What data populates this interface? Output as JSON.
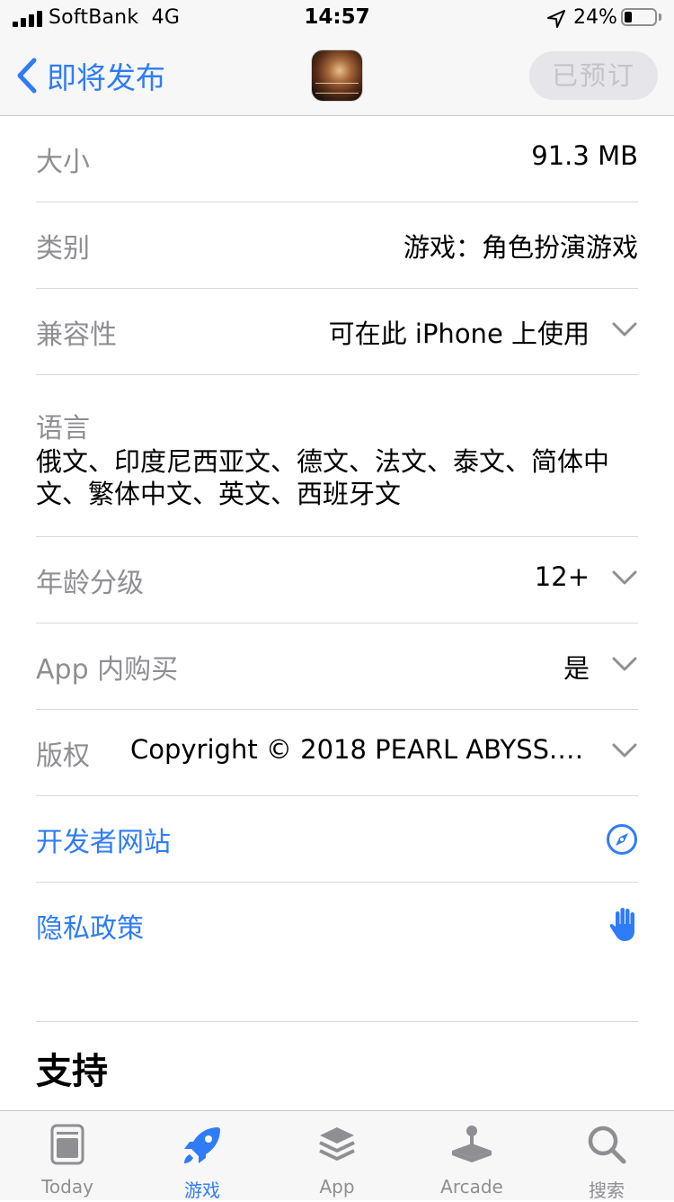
{
  "status_bar": {
    "carrier": "SoftBank",
    "network": "4G",
    "time": "14:57",
    "battery_percent": "24%",
    "battery_level": 0.24
  },
  "nav": {
    "back_label": "即将发布",
    "preorder_label": "已预订"
  },
  "info": {
    "size": {
      "label": "大小",
      "value": "91.3 MB"
    },
    "category": {
      "label": "类别",
      "value": "游戏：角色扮演游戏"
    },
    "compatibility": {
      "label": "兼容性",
      "value": "可在此 iPhone 上使用"
    },
    "languages": {
      "label": "语言",
      "value": "俄文、印度尼西亚文、德文、法文、泰文、简体中文、繁体中文、英文、西班牙文"
    },
    "age_rating": {
      "label": "年龄分级",
      "value": "12+"
    },
    "in_app_purchase": {
      "label": "App 内购买",
      "value": "是"
    },
    "copyright": {
      "label": "版权",
      "value": "Copyright © 2018 PEARL ABYSS. Al..."
    },
    "developer_site": {
      "label": "开发者网站"
    },
    "privacy_policy": {
      "label": "隐私政策"
    }
  },
  "section": {
    "support_title": "支持"
  },
  "tabs": [
    {
      "label": "Today",
      "icon": "today-icon",
      "active": false
    },
    {
      "label": "游戏",
      "icon": "rocket-icon",
      "active": true
    },
    {
      "label": "App",
      "icon": "layers-icon",
      "active": false
    },
    {
      "label": "Arcade",
      "icon": "joystick-icon",
      "active": false
    },
    {
      "label": "搜索",
      "icon": "search-icon",
      "active": false
    }
  ],
  "colors": {
    "accent": "#2f7cf6",
    "label_gray": "#8e8e93",
    "bar_background": "#f7f7f7",
    "separator": "#d8d8dc"
  }
}
